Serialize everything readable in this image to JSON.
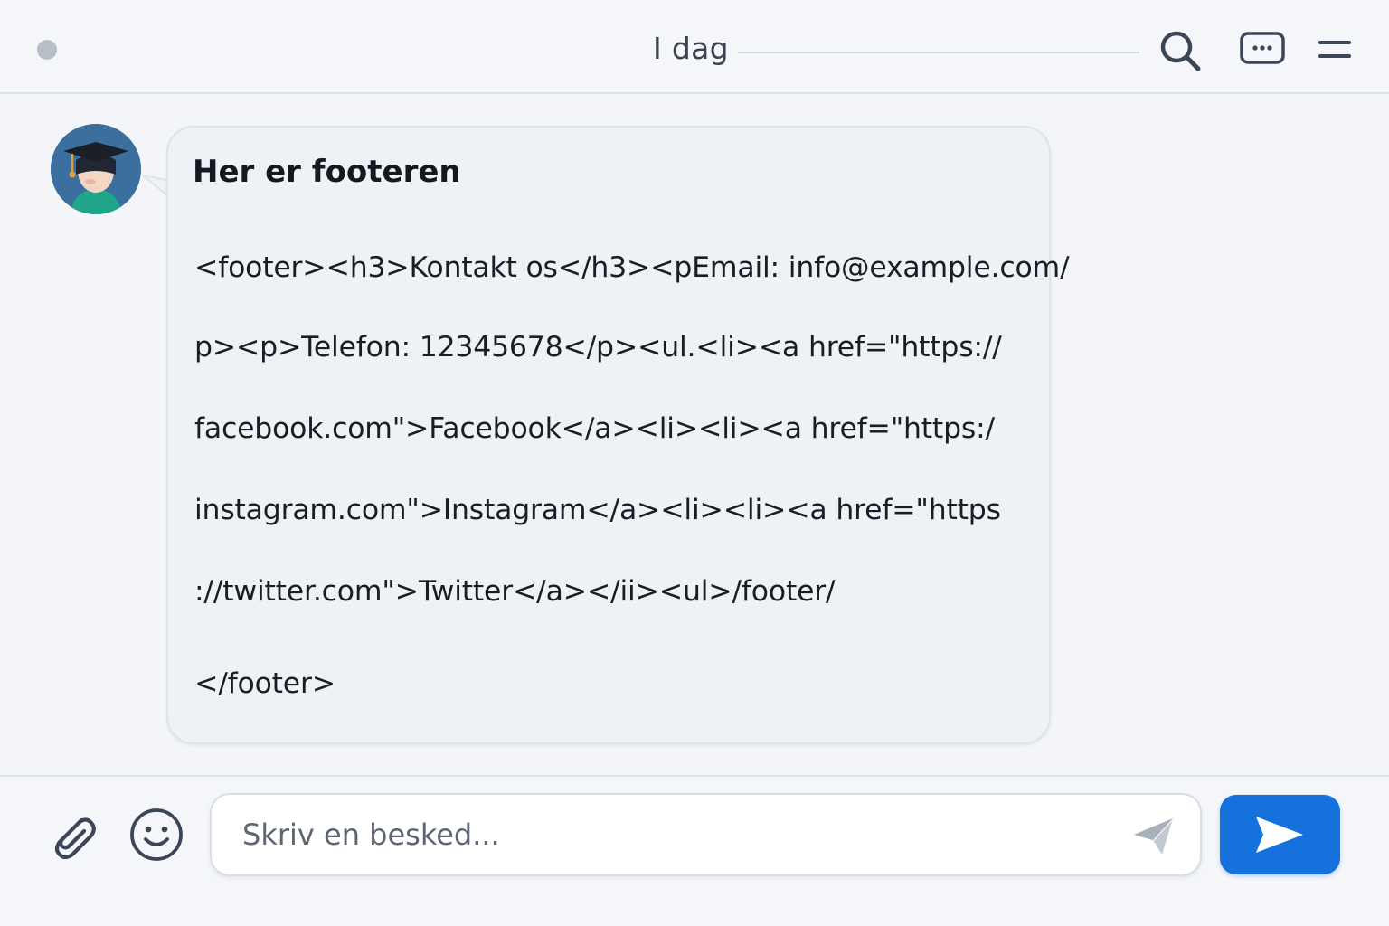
{
  "header": {
    "day_label": "I dag",
    "icons": [
      "search-icon",
      "chat-bubble-icon",
      "menu-icon"
    ]
  },
  "message": {
    "title": "Her er footeren",
    "code_lines": [
      "<footer><h3>Kontakt os</h3><pEmail: info@example.com/",
      "p><p>Telefon: 12345678</p><ul.<li><a href=\"https://",
      "facebook.com\">Facebook</a><li><li><a href=\"https:/",
      "instagram.com\">Instagram</a><li><li><a href=\"https",
      "://twitter.com\">Twitter</a></ii><ul>/footer/",
      "</footer>"
    ],
    "avatar_icon": "graduate-avatar-icon"
  },
  "composer": {
    "placeholder": "Skriv en besked...",
    "value": "",
    "icons": [
      "paperclip-icon",
      "smiley-icon",
      "send-plane-icon",
      "send-arrow-icon"
    ]
  },
  "colors": {
    "background": "#f3f5f8",
    "bubble": "#eef1f5",
    "accent": "#1571dc",
    "text": "#1c1f26",
    "muted": "#5d6675"
  }
}
